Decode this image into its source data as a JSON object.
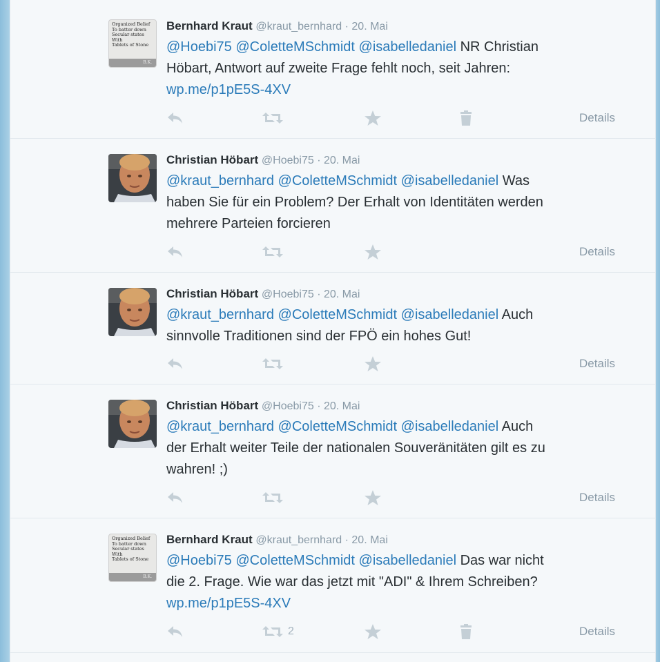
{
  "tweets": [
    {
      "avatar": "organized-belief-sign",
      "name": "Bernhard Kraut",
      "handle": "@kraut_bernhard",
      "date": "20. Mai",
      "mentions": [
        "@Hoebi75",
        "@ColetteMSchmidt",
        "@isabelledaniel"
      ],
      "text_line1_rest": " NR Christian",
      "text_line2": "Höbart, Antwort auf zweite Frage fehlt noch, seit Jahren:",
      "link": "wp.me/p1pE5S-4XV",
      "retweet_count": "",
      "details": "Details"
    },
    {
      "avatar": "christian-photo",
      "name": "Christian Höbart",
      "handle": "@Hoebi75",
      "date": "20. Mai",
      "mentions": [
        "@kraut_bernhard",
        "@ColetteMSchmidt",
        "@isabelledaniel"
      ],
      "text_line1_rest": " Was",
      "text_line2": "haben Sie für ein Problem? Der Erhalt von Identitäten werden",
      "text_line3": "mehrere Parteien forcieren",
      "details": "Details"
    },
    {
      "avatar": "christian-photo",
      "name": "Christian Höbart",
      "handle": "@Hoebi75",
      "date": "20. Mai",
      "mentions": [
        "@kraut_bernhard",
        "@ColetteMSchmidt",
        "@isabelledaniel"
      ],
      "text_line1_rest": " Auch",
      "text_line2": "sinnvolle Traditionen sind der FPÖ ein hohes Gut!",
      "details": "Details"
    },
    {
      "avatar": "christian-photo",
      "name": "Christian Höbart",
      "handle": "@Hoebi75",
      "date": "20. Mai",
      "mentions": [
        "@kraut_bernhard",
        "@ColetteMSchmidt",
        "@isabelledaniel"
      ],
      "text_line1_rest": " Auch",
      "text_line2": "der Erhalt weiter Teile der nationalen Souveränitäten gilt es zu",
      "text_line3": "wahren! ;)",
      "details": "Details"
    },
    {
      "avatar": "organized-belief-sign",
      "name": "Bernhard Kraut",
      "handle": "@kraut_bernhard",
      "date": "20. Mai",
      "mentions": [
        "@Hoebi75",
        "@ColetteMSchmidt",
        "@isabelledaniel"
      ],
      "text_line1_rest": " Das war nicht",
      "text_line2": "die 2. Frage. Wie war das jetzt mit \"ADI\" & Ihrem Schreiben?",
      "link": "wp.me/p1pE5S-4XV",
      "retweet_count": "2",
      "details": "Details"
    }
  ],
  "sign_avatar": {
    "lines": [
      "Organized Belief",
      "To batter down",
      "Secular states",
      "With",
      "Tablets of Stone"
    ],
    "footer": "B.K."
  },
  "separator": " · ",
  "icons": {
    "reply": "reply-arrow-icon",
    "retweet": "retweet-arrows-icon",
    "favorite": "star-icon",
    "delete": "trash-icon"
  },
  "colors": {
    "link": "#2b7bb9",
    "icon": "#c4cfd6",
    "meta": "#8899a6"
  }
}
